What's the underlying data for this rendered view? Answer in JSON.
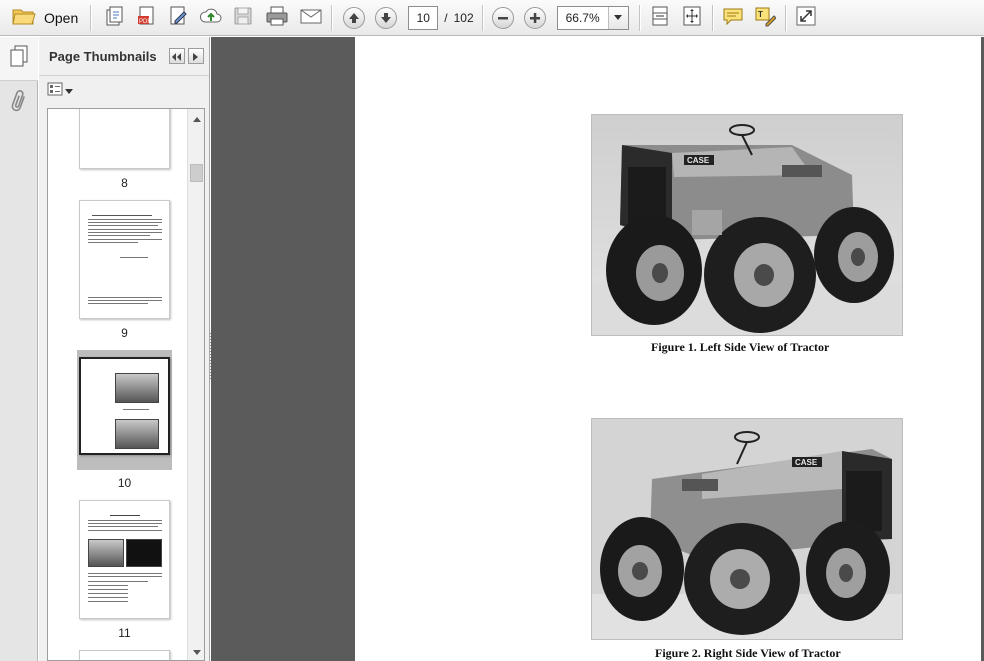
{
  "toolbar": {
    "open_label": "Open",
    "current_page": "10",
    "page_separator": "/",
    "total_pages": "102",
    "zoom_value": "66.7%",
    "icons": [
      "open-folder-icon",
      "create-pdf-icon",
      "export-pdf-icon",
      "edit-pdf-icon",
      "cloud-upload-icon",
      "save-icon",
      "print-icon",
      "email-icon",
      "previous-page-icon",
      "next-page-icon",
      "zoom-out-icon",
      "zoom-in-icon",
      "fit-width-icon",
      "fit-page-icon",
      "comment-icon",
      "highlight-icon",
      "fullscreen-icon"
    ]
  },
  "sidebar": {
    "rail_icons": [
      "page-thumbnails-icon",
      "attachments-icon"
    ]
  },
  "thumbnails_panel": {
    "title": "Page Thumbnails",
    "thumbnails": [
      {
        "page_label": "8"
      },
      {
        "page_label": "9"
      },
      {
        "page_label": "10",
        "selected": true
      },
      {
        "page_label": "11"
      }
    ]
  },
  "document": {
    "figures": [
      {
        "caption": "Figure 1. Left Side View of Tractor"
      },
      {
        "caption": "Figure 2. Right Side View of Tractor"
      }
    ]
  },
  "colors": {
    "viewer_background": "#5b5b5b",
    "toolbar_background": "#f0f0f0",
    "panel_background": "#f0f0f0"
  }
}
